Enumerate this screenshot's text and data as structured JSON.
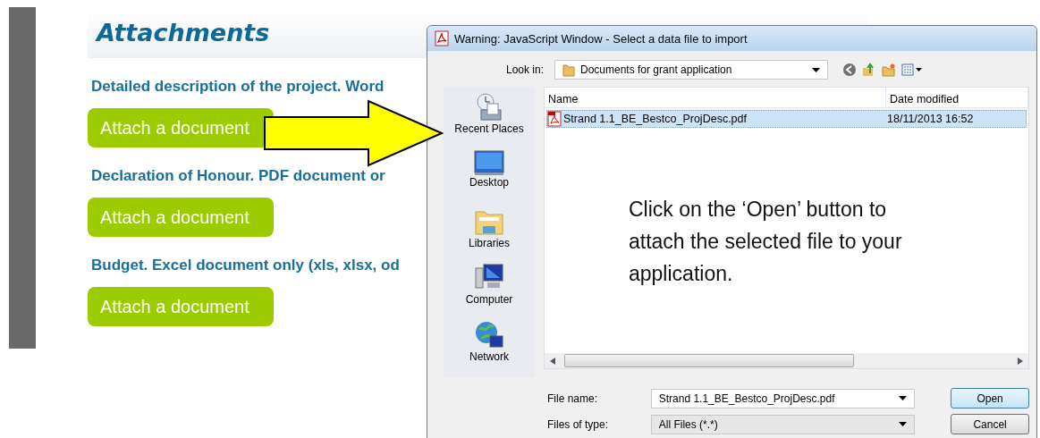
{
  "page": {
    "heading": "Attachments",
    "sections": [
      {
        "label": "Detailed description of the project. Word",
        "button": "Attach a document"
      },
      {
        "label": "Declaration of Honour. PDF document or",
        "button": "Attach a document"
      },
      {
        "label": "Budget. Excel document only (xls, xlsx, od",
        "button": "Attach a document"
      }
    ]
  },
  "dialog": {
    "title": "Warning: JavaScript Window - Select a data file to import",
    "look_in": {
      "label": "Look in:",
      "value": "Documents for grant application"
    },
    "places": [
      {
        "label": "Recent Places",
        "kind": "recent"
      },
      {
        "label": "Desktop",
        "kind": "desktop"
      },
      {
        "label": "Libraries",
        "kind": "libraries"
      },
      {
        "label": "Computer",
        "kind": "computer"
      },
      {
        "label": "Network",
        "kind": "network"
      }
    ],
    "columns": [
      "Name",
      "Date modified"
    ],
    "files": [
      {
        "name": "Strand 1.1_BE_Bestco_ProjDesc.pdf",
        "date": "18/11/2013 16:52",
        "selected": true
      }
    ],
    "file_name": {
      "label": "File name:",
      "value": "Strand 1.1_BE_Bestco_ProjDesc.pdf"
    },
    "file_type": {
      "label": "Files of type:",
      "value": "All Files (*.*)"
    },
    "buttons": [
      {
        "label": "Open",
        "default": true
      },
      {
        "label": "Cancel",
        "default": false
      }
    ]
  },
  "callout": "Click on the ‘Open’ button to attach the selected file to your application."
}
